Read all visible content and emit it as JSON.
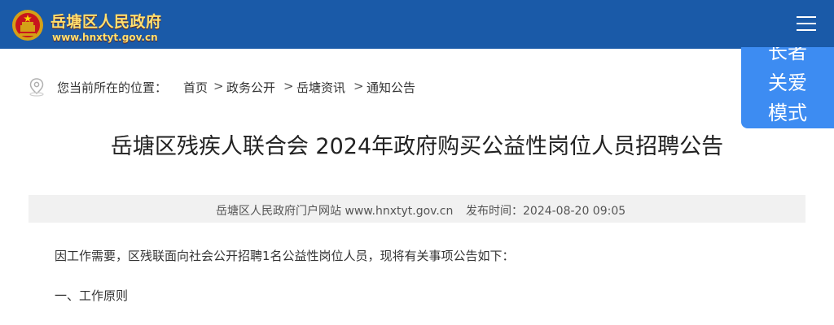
{
  "header": {
    "site_name": "岳塘区人民政府",
    "site_url": "www.hnxtyt.gov.cn",
    "emblem_icon": "national-emblem-icon",
    "menu_icon": "hamburger-menu-icon",
    "colors": {
      "bar": "#1a5aa8",
      "site_text": "#ffe070"
    }
  },
  "elder_mode": {
    "lines": [
      "长者",
      "关爱",
      "模式"
    ],
    "color": "#3d8cf2"
  },
  "breadcrumb": {
    "icon": "location-pin-icon",
    "lead": "您当前所在的位置：",
    "items": [
      "首页",
      "政务公开",
      "岳塘资讯",
      "通知公告"
    ],
    "separator": ">"
  },
  "article": {
    "title": "岳塘区残疾人联合会 2024年政府购买公益性岗位人员招聘公告",
    "source": "岳塘区人民政府门户网站 www.hnxtyt.gov.cn",
    "publish_label": "发布时间：",
    "publish_time": "2024-08-20 09:05",
    "paragraphs": [
      "因工作需要，区残联面向社会公开招聘1名公益性岗位人员，现将有关事项公告如下：",
      "一、工作原则"
    ]
  }
}
